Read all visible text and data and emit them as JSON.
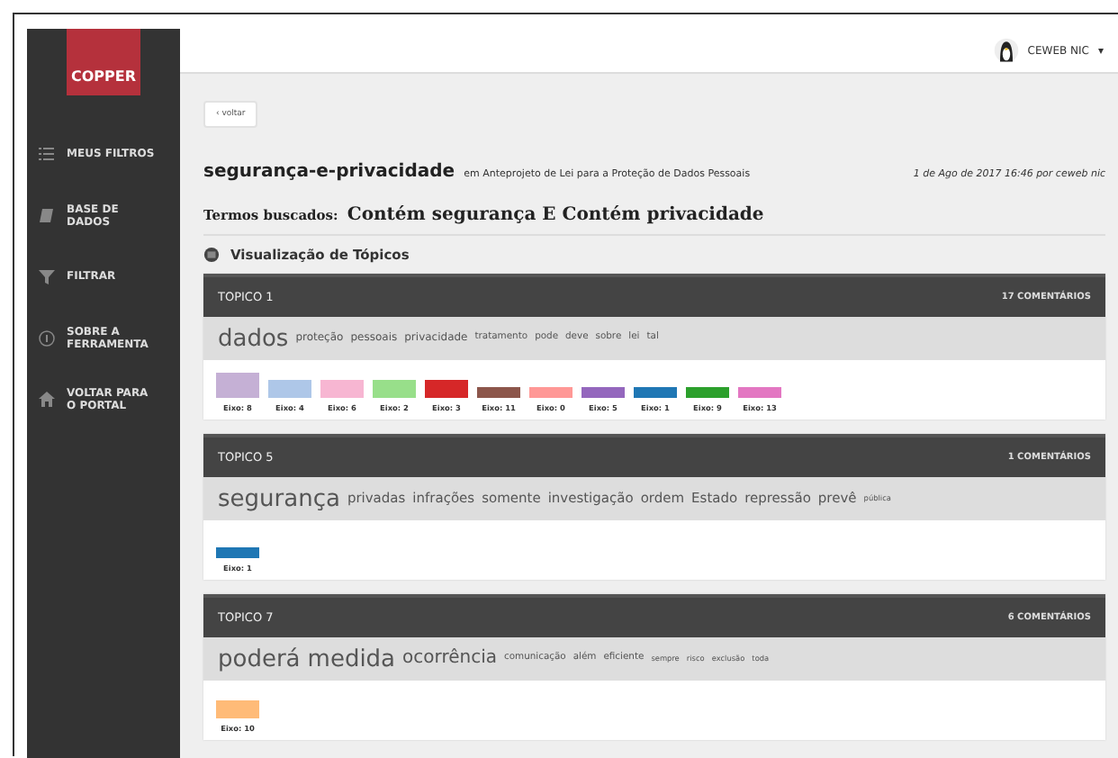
{
  "sidebar": {
    "logo": "COPPER",
    "items": [
      {
        "label": "MEUS FILTROS"
      },
      {
        "label": "BASE DE DADOS"
      },
      {
        "label": "FILTRAR"
      },
      {
        "label": "SOBRE A FERRAMENTA"
      },
      {
        "label": "VOLTAR PARA O PORTAL"
      }
    ]
  },
  "topbar": {
    "user": "CEWEB NIC",
    "caret": "▾"
  },
  "back_button": "‹ voltar",
  "title": "segurança-e-privacidade",
  "subtitle": "em Anteprojeto de Lei para a Proteção de Dados Pessoais",
  "meta": "1 de Ago de 2017 16:46 por ceweb nic",
  "search_terms": {
    "label": "Termos buscados:",
    "value": "Contém segurança E Contém privacidade"
  },
  "section_title": "Visualização de Tópicos",
  "topics": [
    {
      "title": "TOPICO 1",
      "comments": "17 COMENTÁRIOS",
      "words": [
        {
          "text": "dados",
          "kind": "xl"
        },
        {
          "text": "proteção",
          "kind": "s"
        },
        {
          "text": "pessoais",
          "kind": "s"
        },
        {
          "text": "privacidade",
          "kind": "s"
        },
        {
          "text": "tratamento",
          "kind": "xs"
        },
        {
          "text": "pode",
          "kind": "xs"
        },
        {
          "text": "deve",
          "kind": "xs"
        },
        {
          "text": "sobre",
          "kind": "xs"
        },
        {
          "text": "lei",
          "kind": "xs"
        },
        {
          "text": "tal",
          "kind": "xs"
        }
      ],
      "axes": [
        {
          "label": "Eixo: 8",
          "color": "#c5b0d5",
          "kind": "tall"
        },
        {
          "label": "Eixo: 4",
          "color": "#aec7e8",
          "kind": "medium"
        },
        {
          "label": "Eixo: 6",
          "color": "#f7b6d2",
          "kind": "medium"
        },
        {
          "label": "Eixo: 2",
          "color": "#98df8a",
          "kind": "medium"
        },
        {
          "label": "Eixo: 3",
          "color": "#d62728",
          "kind": "medium"
        },
        {
          "label": "Eixo: 11",
          "color": "#8c564b",
          "kind": "short"
        },
        {
          "label": "Eixo: 0",
          "color": "#ff9896",
          "kind": "short"
        },
        {
          "label": "Eixo: 5",
          "color": "#9467bd",
          "kind": "short"
        },
        {
          "label": "Eixo: 1",
          "color": "#1f77b4",
          "kind": "short"
        },
        {
          "label": "Eixo: 9",
          "color": "#2ca02c",
          "kind": "short"
        },
        {
          "label": "Eixo: 13",
          "color": "#e377c2",
          "kind": "short"
        }
      ]
    },
    {
      "title": "TOPICO 5",
      "comments": "1 COMENTÁRIOS",
      "words": [
        {
          "text": "segurança",
          "kind": "xl"
        },
        {
          "text": "privadas",
          "kind": "m"
        },
        {
          "text": "infrações",
          "kind": "m"
        },
        {
          "text": "somente",
          "kind": "m"
        },
        {
          "text": "investigação",
          "kind": "m"
        },
        {
          "text": "ordem",
          "kind": "m"
        },
        {
          "text": "Estado",
          "kind": "m"
        },
        {
          "text": "repressão",
          "kind": "m"
        },
        {
          "text": "prevê",
          "kind": "m"
        },
        {
          "text": "pública",
          "kind": "xxs"
        }
      ],
      "axes": [
        {
          "label": "Eixo: 1",
          "color": "#1f77b4",
          "kind": "short"
        }
      ]
    },
    {
      "title": "TOPICO 7",
      "comments": "6 COMENTÁRIOS",
      "words": [
        {
          "text": "poderá",
          "kind": "xl"
        },
        {
          "text": "medida",
          "kind": "xl"
        },
        {
          "text": "ocorrência",
          "kind": "l"
        },
        {
          "text": "comunicação",
          "kind": "xs"
        },
        {
          "text": "além",
          "kind": "xs"
        },
        {
          "text": "eficiente",
          "kind": "xs"
        },
        {
          "text": "sempre",
          "kind": "xxs"
        },
        {
          "text": "risco",
          "kind": "xxs"
        },
        {
          "text": "exclusão",
          "kind": "xxs"
        },
        {
          "text": "toda",
          "kind": "xxs"
        }
      ],
      "axes": [
        {
          "label": "Eixo: 10",
          "color": "#ffbb78",
          "kind": "medium"
        }
      ]
    }
  ]
}
